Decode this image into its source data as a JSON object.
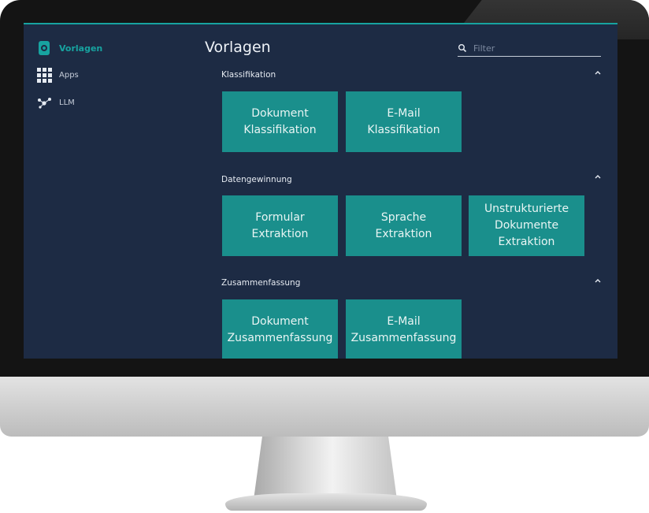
{
  "colors": {
    "accent": "#17a3a0",
    "tile": "#1a8f8c",
    "screen_bg": "#1d2b44"
  },
  "sidebar": {
    "items": [
      {
        "label": "Vorlagen",
        "icon": "template-icon",
        "active": true
      },
      {
        "label": "Apps",
        "icon": "apps-grid-icon",
        "active": false
      },
      {
        "label": "LLM",
        "icon": "llm-network-icon",
        "active": false
      }
    ]
  },
  "main": {
    "title": "Vorlagen",
    "filter": {
      "placeholder": "Filter",
      "value": ""
    },
    "sections": [
      {
        "title": "Klassifikation",
        "tiles": [
          {
            "label": "Dokument\nKlassifikation"
          },
          {
            "label": "E-Mail\nKlassifikation"
          }
        ]
      },
      {
        "title": "Datengewinnung",
        "tiles": [
          {
            "label": "Formular\nExtraktion"
          },
          {
            "label": "Sprache\nExtraktion"
          },
          {
            "label": "Unstrukturierte\nDokumente\nExtraktion"
          }
        ]
      },
      {
        "title": "Zusammenfassung",
        "tiles": [
          {
            "label": "Dokument\nZusammenfassung"
          },
          {
            "label": "E-Mail\nZusammenfassung"
          }
        ]
      }
    ]
  }
}
